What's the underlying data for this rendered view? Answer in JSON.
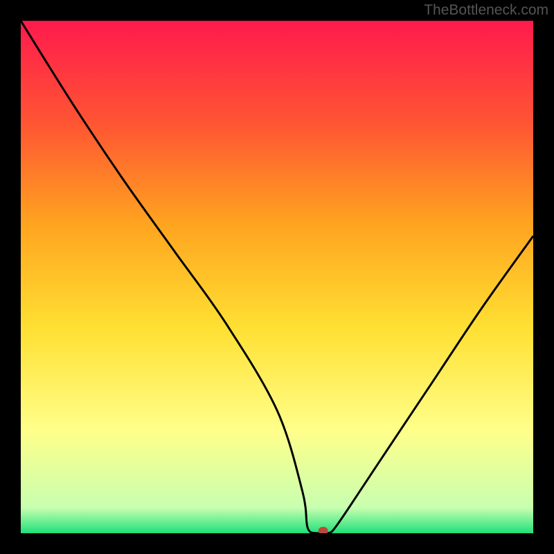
{
  "watermark": "TheBottleneck.com",
  "chart_data": {
    "type": "line",
    "title": "",
    "xlabel": "",
    "ylabel": "",
    "xlim": [
      0,
      100
    ],
    "ylim": [
      0,
      100
    ],
    "series": [
      {
        "name": "curve",
        "x": [
          0,
          10,
          20,
          30,
          40,
          50,
          55,
          56,
          58,
          60,
          62,
          70,
          80,
          90,
          100
        ],
        "values": [
          100,
          84,
          69,
          55,
          41,
          24,
          8,
          1,
          0,
          0,
          2,
          14,
          29,
          44,
          58
        ]
      }
    ],
    "marker": {
      "x": 59,
      "y": 0.5
    },
    "gradient_stops": [
      {
        "offset": 0.0,
        "color": "#ff1a4d"
      },
      {
        "offset": 0.2,
        "color": "#ff5533"
      },
      {
        "offset": 0.4,
        "color": "#ffa51f"
      },
      {
        "offset": 0.6,
        "color": "#ffe033"
      },
      {
        "offset": 0.8,
        "color": "#ffff8a"
      },
      {
        "offset": 0.95,
        "color": "#c8ffb0"
      },
      {
        "offset": 1.0,
        "color": "#1fe07a"
      }
    ],
    "colors": {
      "border": "#000000",
      "line": "#000000",
      "marker": "#bc483a"
    }
  }
}
